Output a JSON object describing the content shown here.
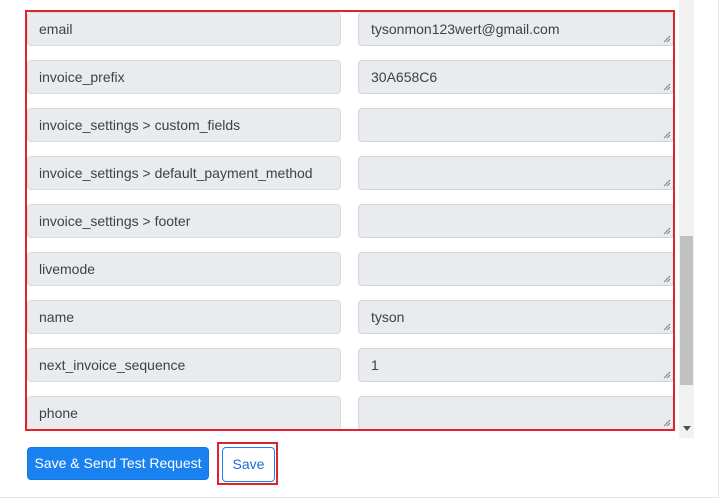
{
  "fields": [
    {
      "name": "email",
      "value": "tysonmon123wert@gmail.com"
    },
    {
      "name": "invoice_prefix",
      "value": "30A658C6"
    },
    {
      "name": "invoice_settings > custom_fields",
      "value": ""
    },
    {
      "name": "invoice_settings > default_payment_method",
      "value": ""
    },
    {
      "name": "invoice_settings > footer",
      "value": ""
    },
    {
      "name": "livemode",
      "value": ""
    },
    {
      "name": "name",
      "value": "tyson"
    },
    {
      "name": "next_invoice_sequence",
      "value": "1"
    },
    {
      "name": "phone",
      "value": ""
    }
  ],
  "actions": {
    "send_test_label": "Save & Send Test Request",
    "save_label": "Save"
  },
  "colors": {
    "primary": "#1a82f0",
    "highlight": "#e0232b",
    "field_background": "#e9ebee"
  }
}
